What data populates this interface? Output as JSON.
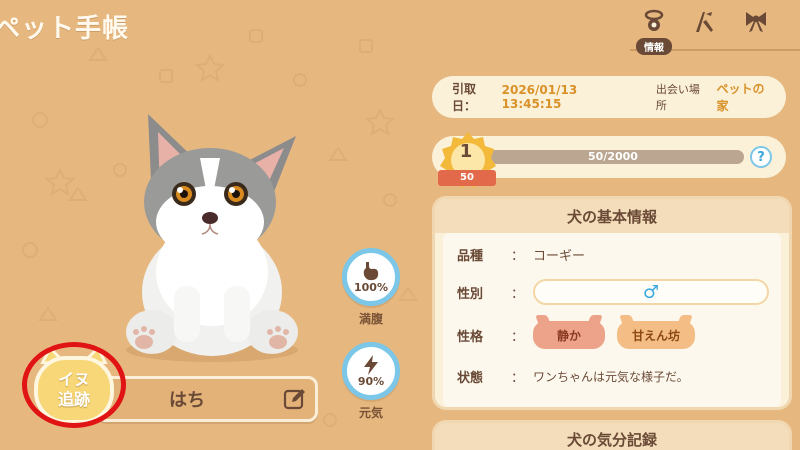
{
  "header": {
    "title": "ペット手帳"
  },
  "tabs": [
    {
      "name": "info",
      "label": "情報",
      "icon": "collar-tag-icon",
      "active": true
    },
    {
      "name": "skills",
      "icon": "agility-icon"
    },
    {
      "name": "accessories",
      "icon": "bow-icon"
    }
  ],
  "adoption": {
    "date_label": "引取日：",
    "date": "2026/01/13 13:45:15",
    "place_label": "出会い場所",
    "place": "ペットの家"
  },
  "level": {
    "value": "1",
    "ribbon": "50",
    "xp_text": "50/2000",
    "xp_fraction": 0.025,
    "help": "?"
  },
  "stats": {
    "fullness": {
      "value": "100%",
      "label": "満腹",
      "icon": "stomach-icon"
    },
    "energy": {
      "value": "90%",
      "label": "元気",
      "icon": "lightning-icon"
    }
  },
  "pet": {
    "name": "はち"
  },
  "tracking": {
    "line1": "イヌ",
    "line2": "追跡"
  },
  "basic_info": {
    "title": "犬の基本情報",
    "breed_label": "品種",
    "breed": "コーギー",
    "gender_label": "性別",
    "gender": "♂",
    "personality_label": "性格",
    "traits": [
      "静か",
      "甘えん坊"
    ],
    "status_label": "状態",
    "status": "ワンちゃんは元気な様子だ。",
    "colon": "："
  },
  "mood": {
    "title": "犬の気分記録"
  },
  "colors": {
    "background": "#e6b87f",
    "card": "#fbf1d9",
    "accent_orange": "#d9922a",
    "ring_blue": "#7cc6e8",
    "highlight_red": "#e01414"
  }
}
